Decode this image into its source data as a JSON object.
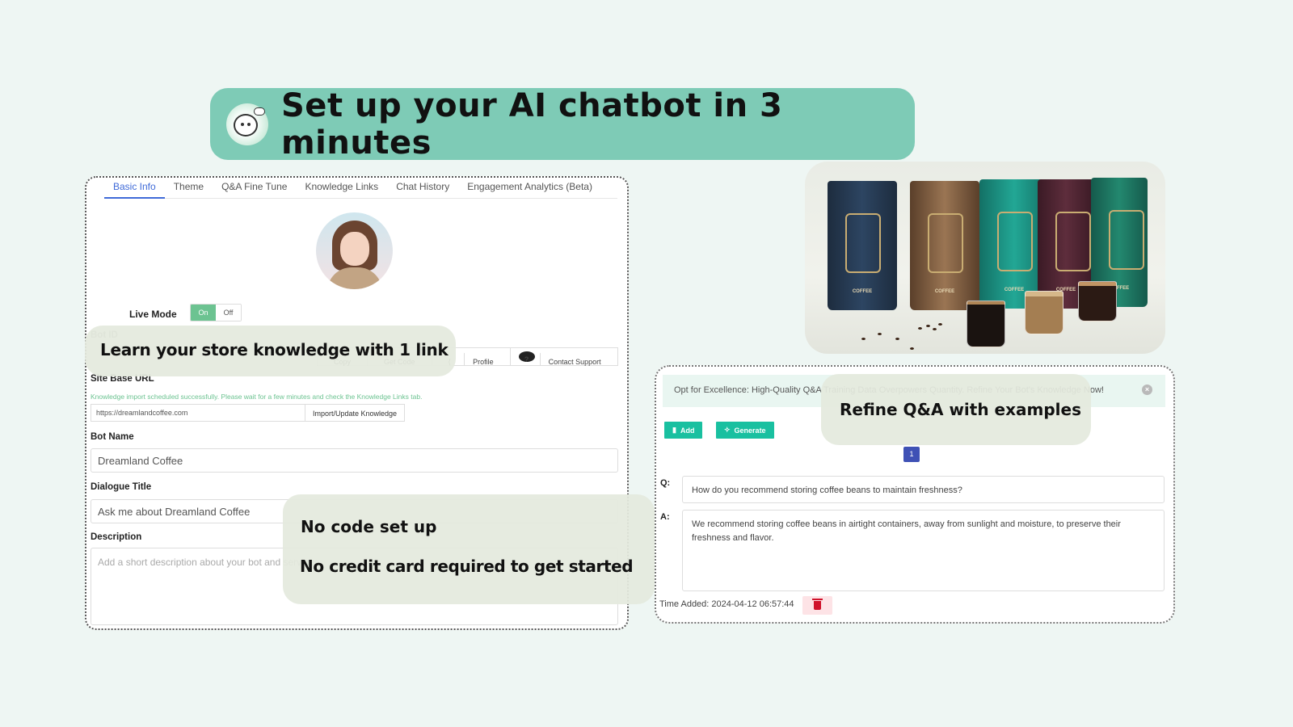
{
  "banner": {
    "title": "Set up your AI chatbot in 3 minutes",
    "logo_icon": "chat-bubble-mascot-icon",
    "color": "#7ecbb6"
  },
  "left_panel": {
    "tabs": [
      {
        "label": "Basic Info",
        "active": true
      },
      {
        "label": "Theme",
        "active": false
      },
      {
        "label": "Q&A Fine Tune",
        "active": false
      },
      {
        "label": "Knowledge Links",
        "active": false
      },
      {
        "label": "Chat History",
        "active": false
      },
      {
        "label": "Engagement Analytics (Beta)",
        "active": false
      }
    ],
    "live_mode": {
      "label": "Live Mode",
      "on_label": "On",
      "off_label": "Off",
      "value": "On"
    },
    "bot_id": {
      "label": "Bot ID",
      "buttons": [
        "Copy",
        "Get Code",
        "Profile",
        "Contact Support"
      ]
    },
    "site_base_url": {
      "label": "Site Base URL",
      "status_message": "Knowledge import scheduled successfully. Please wait for a few minutes and check the Knowledge Links tab.",
      "value": "https://dreamlandcoffee.com",
      "button": "Import/Update Knowledge"
    },
    "bot_name": {
      "label": "Bot Name",
      "value": "Dreamland Coffee"
    },
    "dialogue_title": {
      "label": "Dialogue Title",
      "value": "Ask me about Dreamland Coffee"
    },
    "description": {
      "label": "Description",
      "placeholder": "Add a short description about your bot and services"
    }
  },
  "overlays": {
    "learn": "Learn your store knowledge with 1 link",
    "no_code": "No code set up",
    "no_card": "No credit card required to get started",
    "refine": "Refine Q&A with examples"
  },
  "product_image": {
    "alt": "Coffee bags and glasses of coffee",
    "bag_label": "COFFEE",
    "bag_colors": [
      "#27394f",
      "#7a5a3e",
      "#1b8f83",
      "#4e2431",
      "#1d7a67"
    ]
  },
  "qa_panel": {
    "alert": "Opt for Excellence: High-Quality Q&A Training Data Overpowers Quantity. Refine Your Bot's Knowledge Now!",
    "add_label": "Add",
    "generate_label": "Generate",
    "page": "1",
    "q_label": "Q:",
    "question": "How do you recommend storing coffee beans to maintain freshness?",
    "a_label": "A:",
    "answer": "We recommend storing coffee beans in airtight containers, away from sunlight and moisture, to preserve their freshness and flavor.",
    "time_added": "Time Added: 2024-04-12 06:57:44"
  }
}
